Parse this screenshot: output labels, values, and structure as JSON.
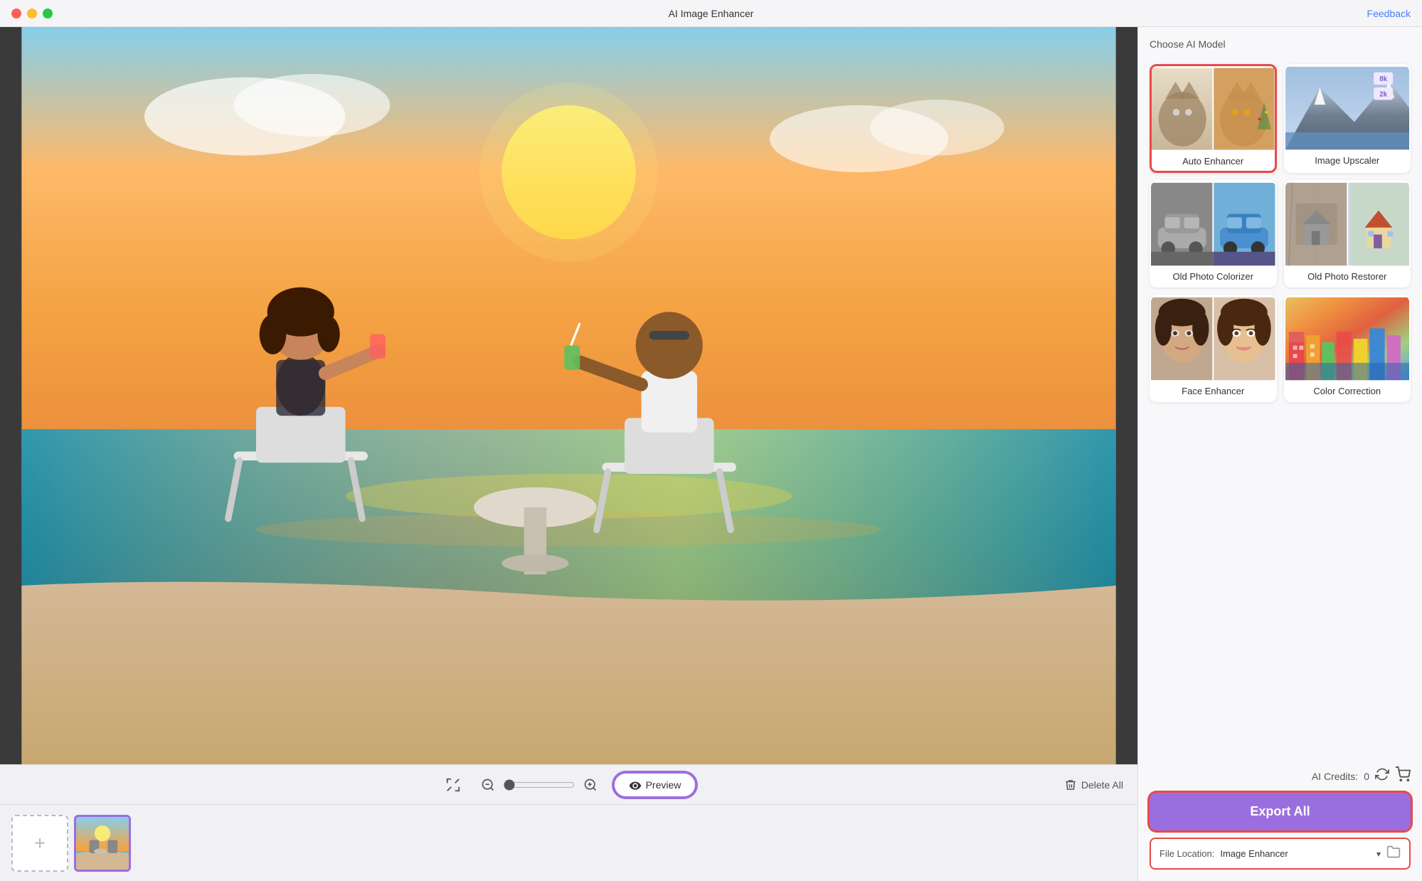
{
  "titlebar": {
    "title": "AI Image Enhancer",
    "feedback_label": "Feedback"
  },
  "toolbar": {
    "preview_label": "Preview",
    "delete_all_label": "Delete All",
    "zoom_value": 0
  },
  "right_panel": {
    "section_title": "Choose AI Model",
    "models": [
      {
        "id": "auto_enhancer",
        "label": "Auto Enhancer",
        "selected": true
      },
      {
        "id": "image_upscaler",
        "label": "Image Upscaler",
        "selected": false
      },
      {
        "id": "old_photo_colorizer",
        "label": "Old Photo Colorizer",
        "selected": false
      },
      {
        "id": "old_photo_restorer",
        "label": "Old Photo Restorer",
        "selected": false
      },
      {
        "id": "face_enhancer",
        "label": "Face Enhancer",
        "selected": false
      },
      {
        "id": "color_correction",
        "label": "Color Correction",
        "selected": false
      }
    ],
    "ai_credits": {
      "label": "AI Credits:",
      "count": "0"
    },
    "export_btn_label": "Export All",
    "file_location": {
      "label": "File Location:",
      "value": "Image Enhancer"
    }
  },
  "upscaler_badges": {
    "badge1": "8k",
    "badge2": "2k"
  }
}
